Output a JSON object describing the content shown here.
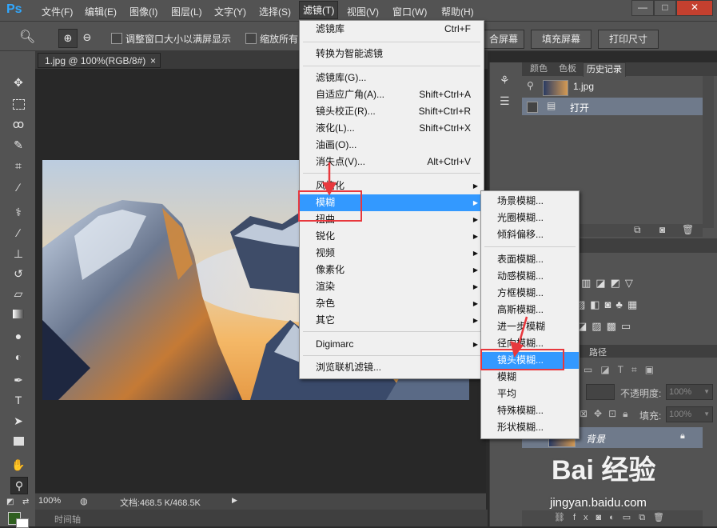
{
  "app": {
    "logo": "Ps"
  },
  "menubar": {
    "items": [
      "文件(F)",
      "编辑(E)",
      "图像(I)",
      "图层(L)",
      "文字(Y)",
      "选择(S)",
      "滤镜(T)",
      "视图(V)",
      "窗口(W)",
      "帮助(H)"
    ],
    "active": "滤镜(T)"
  },
  "window_controls": {
    "minimize": "—",
    "restore": "□",
    "close": "✕"
  },
  "options_bar": {
    "resize_windows_label": "调整窗口大小以满屏显示",
    "zoom_all_label": "缩放所有",
    "fit_screen_partial": "合屏幕",
    "fill_screen_label": "填充屏幕",
    "print_size_label": "打印尺寸"
  },
  "document": {
    "tab_label": "1.jpg @ 100%(RGB/8#)",
    "close": "×"
  },
  "status": {
    "zoom": "100%",
    "doc_info": "文档:468.5 K/468.5K"
  },
  "timeline": {
    "label": "时间轴"
  },
  "panels": {
    "tabs": [
      "颜色",
      "色板",
      "历史记录"
    ],
    "active_tab": "历史记录",
    "history": {
      "snapshot_label": "1.jpg",
      "items": [
        "打开"
      ]
    },
    "layers": {
      "paths_tab": "路径",
      "opacity_label": "不透明度:",
      "opacity_value": "100%",
      "fill_label": "填充:",
      "fill_value": "100%",
      "layer_name": "背景"
    }
  },
  "filter_menu": {
    "items": [
      {
        "label": "滤镜库",
        "shortcut": "Ctrl+F"
      },
      {
        "label": "转换为智能滤镜"
      },
      {
        "label": "滤镜库(G)..."
      },
      {
        "label": "自适应广角(A)...",
        "shortcut": "Shift+Ctrl+A"
      },
      {
        "label": "镜头校正(R)...",
        "shortcut": "Shift+Ctrl+R"
      },
      {
        "label": "液化(L)...",
        "shortcut": "Shift+Ctrl+X"
      },
      {
        "label": "油画(O)..."
      },
      {
        "label": "消失点(V)...",
        "shortcut": "Alt+Ctrl+V"
      },
      {
        "label": "风格化"
      },
      {
        "label": "模糊"
      },
      {
        "label": "扭曲"
      },
      {
        "label": "锐化"
      },
      {
        "label": "视频"
      },
      {
        "label": "像素化"
      },
      {
        "label": "渲染"
      },
      {
        "label": "杂色"
      },
      {
        "label": "其它"
      },
      {
        "label": "Digimarc"
      },
      {
        "label": "浏览联机滤镜..."
      }
    ]
  },
  "blur_submenu": {
    "items": [
      "场景模糊...",
      "光圈模糊...",
      "倾斜偏移...",
      "表面模糊...",
      "动感模糊...",
      "方框模糊...",
      "高斯模糊...",
      "进一步模糊",
      "径向模糊...",
      "镜头模糊...",
      "模糊",
      "平均",
      "特殊模糊...",
      "形状模糊..."
    ]
  },
  "watermark": {
    "brand": "Bai 经验",
    "url": "jingyan.baidu.com"
  },
  "colors": {
    "highlight": "#3399ff",
    "annotation_red": "#e8383d",
    "ps_blue": "#31a8ff"
  }
}
